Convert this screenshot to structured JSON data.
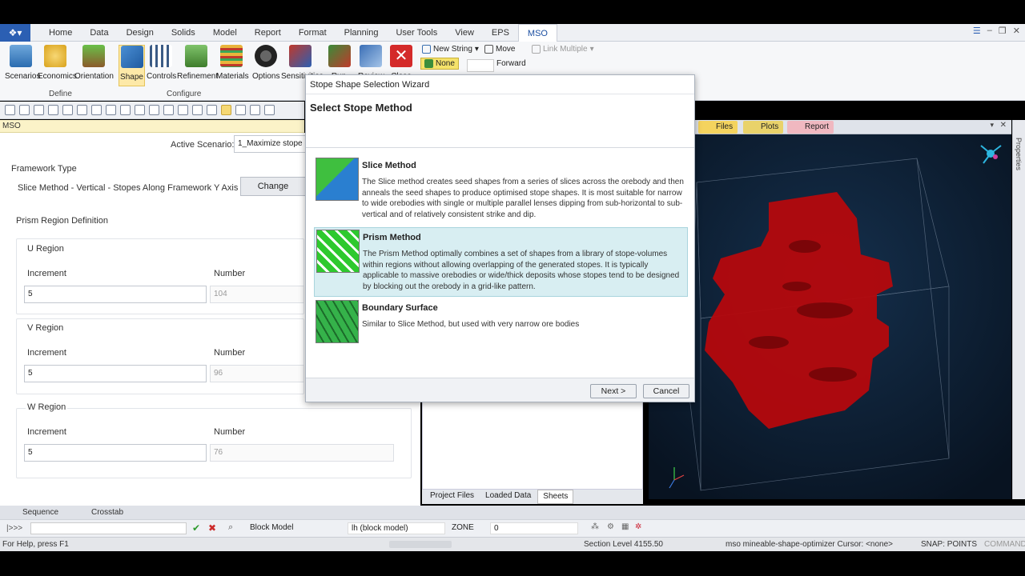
{
  "ribbon_tabs": [
    "Home",
    "Data",
    "Design",
    "Solids",
    "Model",
    "Report",
    "Format",
    "Planning",
    "User Tools",
    "View",
    "EPS",
    "MSO"
  ],
  "ribbon": {
    "scenarios": "Scenarios",
    "economics": "Economics",
    "orientation": "Orientation",
    "shape": "Shape",
    "controls": "Controls",
    "refinement": "Refinement",
    "materials": "Materials",
    "options": "Options",
    "sensitivities": "Sensitivities",
    "run": "Run",
    "review": "Review",
    "close": "Close",
    "new_string": "New String",
    "move": "Move",
    "none": "None",
    "forward": "Forward",
    "link_multiple": "Link Multiple",
    "define": "Define",
    "configure": "Configure"
  },
  "mso_bar": "MSO",
  "form": {
    "active_scenario_label": "Active Scenario:",
    "active_scenario_value": "1_Maximize stope",
    "framework_type_label": "Framework Type",
    "framework_type_value": "Slice Method - Vertical - Stopes Along Framework Y Axis (YZ)",
    "change": "Change",
    "prism_region": "Prism Region Definition",
    "u_region": "U Region",
    "v_region": "V Region",
    "w_region": "W Region",
    "increment": "Increment",
    "number": "Number",
    "u_increment": "5",
    "u_number": "104",
    "v_increment": "5",
    "v_number": "96",
    "w_increment": "5",
    "w_number": "76"
  },
  "dialog": {
    "title": "Stope Shape Selection Wizard",
    "heading": "Select Stope Method",
    "options": [
      {
        "title": "Slice Method",
        "desc": "The Slice method creates seed shapes from a series of slices across the orebody and then anneals the seed shapes to produce optimised stope shapes.  It is most suitable for narrow to wide orebodies with single or multiple parallel lenses dipping from sub-horizontal to sub-vertical and of relatively consistent strike and dip."
      },
      {
        "title": "Prism Method",
        "desc": "The Prism Method optimally combines a set of shapes from a library of stope-volumes within regions without allowing overlapping of the generated stopes. It is typically applicable to massive orebodies or wide/thick deposits whose stopes tend to be designed by blocking out the orebody in a grid-like pattern."
      },
      {
        "title": "Boundary Surface",
        "desc": "Similar to Slice Method, but used with very narrow ore bodies"
      }
    ],
    "next": "Next >",
    "cancel": "Cancel"
  },
  "viewer_tabs": [
    "Files",
    "Plots",
    "Report"
  ],
  "right_sidebar": "Properties",
  "mid_tabs": [
    "Project Files",
    "Loaded Data",
    "Sheets"
  ],
  "bottom_tabs": [
    "Sequence",
    "Crosstab"
  ],
  "cmd": {
    "prompt": "|>>>",
    "block_model": "Block Model",
    "lh_block_model": "lh (block model)",
    "zone": "ZONE",
    "zone_value": "0"
  },
  "status": {
    "help": "For Help, press F1",
    "section_level": "Section Level 4155.50",
    "cursor": "mso mineable-shape-optimizer Cursor: <none>",
    "snap": "SNAP: POINTS",
    "command": "COMMAND"
  },
  "colors": {
    "accent": "#2b5fb3",
    "selected_option": "#d8eef2",
    "orebody": "#b5080d",
    "viewer_bg": "#0d1a2b"
  }
}
